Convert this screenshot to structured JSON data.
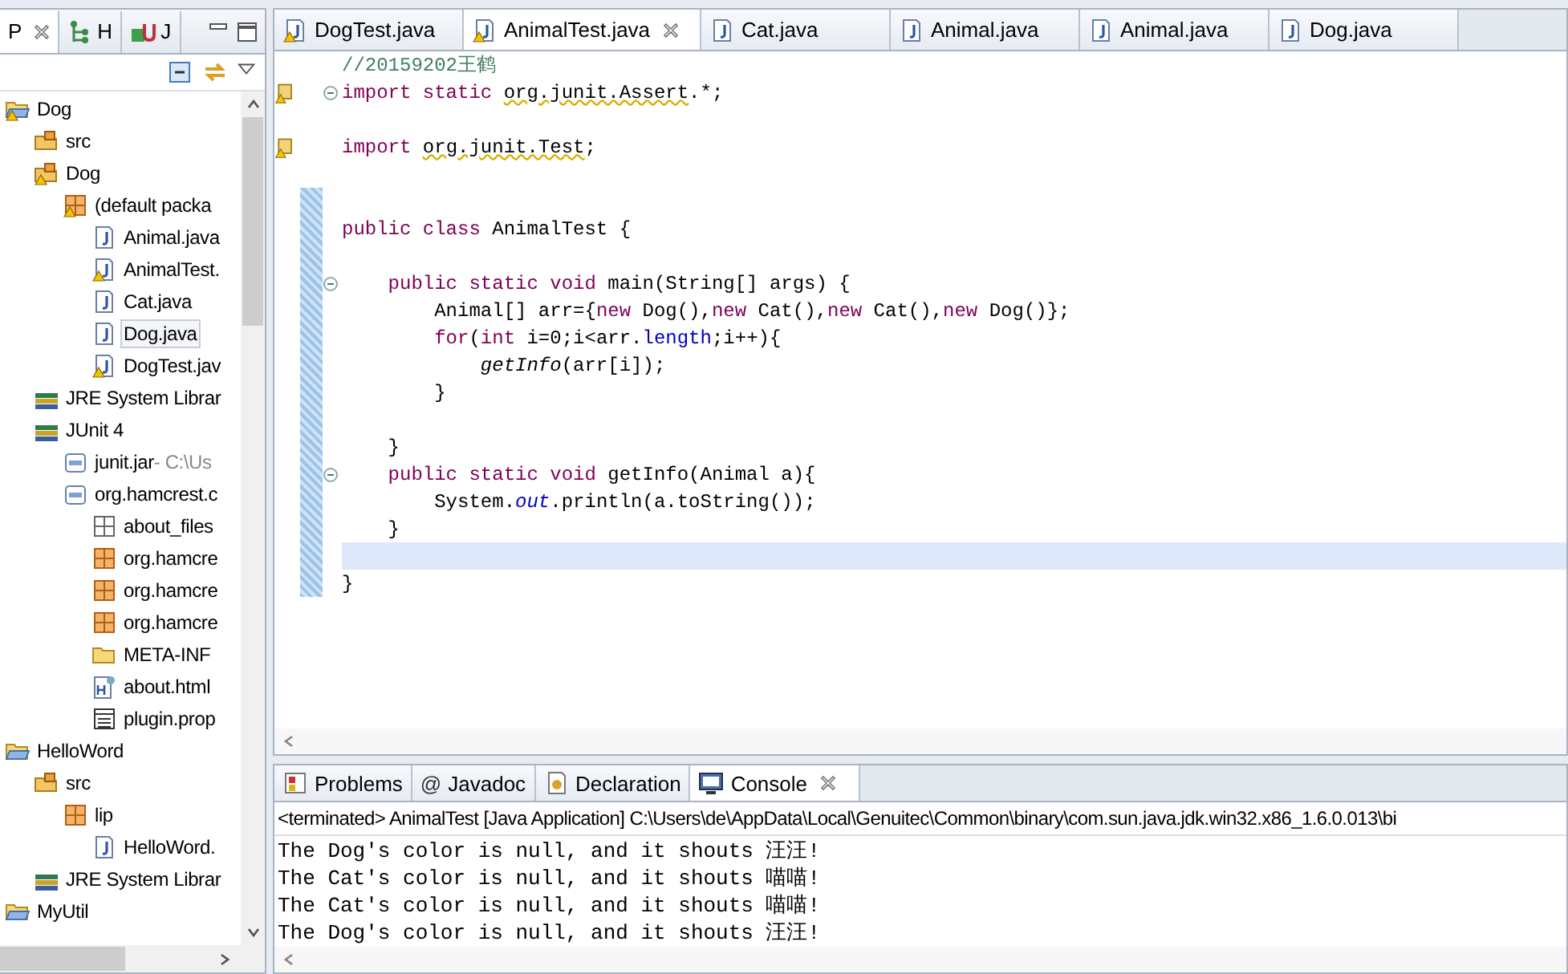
{
  "left_panel": {
    "tabs": [
      {
        "label": "P",
        "kind": "explorer",
        "selected": true
      },
      {
        "label": "H",
        "kind": "hierarchy",
        "selected": false
      },
      {
        "label": "J",
        "kind": "junit",
        "selected": false
      }
    ],
    "tree": [
      {
        "label": "Dog",
        "kind": "project",
        "warning": true,
        "selected": false,
        "children": [
          {
            "label": "src",
            "kind": "srcfolder",
            "warning": false,
            "selected": false
          },
          {
            "label": "Dog",
            "kind": "srcfolder",
            "warning": true,
            "selected": false,
            "children": [
              {
                "label": "(default packa",
                "kind": "package",
                "warning": true,
                "selected": false,
                "children": [
                  {
                    "label": "Animal.java",
                    "kind": "java",
                    "warning": false,
                    "selected": false
                  },
                  {
                    "label": "AnimalTest.",
                    "kind": "java",
                    "warning": true,
                    "selected": false
                  },
                  {
                    "label": "Cat.java",
                    "kind": "java",
                    "warning": false,
                    "selected": false
                  },
                  {
                    "label": "Dog.java",
                    "kind": "java",
                    "warning": false,
                    "selected": true
                  },
                  {
                    "label": "DogTest.jav",
                    "kind": "java",
                    "warning": true,
                    "selected": false
                  }
                ]
              }
            ]
          },
          {
            "label": "JRE System Librar",
            "kind": "library",
            "warning": false,
            "selected": false
          },
          {
            "label": "JUnit 4",
            "kind": "library",
            "warning": false,
            "selected": false,
            "children": [
              {
                "label": "junit.jar",
                "detail": "- C:\\Us",
                "kind": "jar",
                "warning": false,
                "selected": false
              },
              {
                "label": "org.hamcrest.c",
                "kind": "jar",
                "warning": false,
                "selected": false,
                "children": [
                  {
                    "label": "about_files",
                    "kind": "packagefolder",
                    "warning": false,
                    "selected": false
                  },
                  {
                    "label": "org.hamcre",
                    "kind": "package",
                    "warning": false,
                    "selected": false
                  },
                  {
                    "label": "org.hamcre",
                    "kind": "package",
                    "warning": false,
                    "selected": false
                  },
                  {
                    "label": "org.hamcre",
                    "kind": "package",
                    "warning": false,
                    "selected": false
                  },
                  {
                    "label": "META-INF",
                    "kind": "folder",
                    "warning": false,
                    "selected": false
                  },
                  {
                    "label": "about.html",
                    "kind": "html",
                    "warning": false,
                    "selected": false
                  },
                  {
                    "label": "plugin.prop",
                    "kind": "properties",
                    "warning": false,
                    "selected": false
                  }
                ]
              }
            ]
          }
        ]
      },
      {
        "label": "HelloWord",
        "kind": "project",
        "warning": false,
        "selected": false,
        "children": [
          {
            "label": "src",
            "kind": "srcfolder",
            "warning": false,
            "selected": false,
            "children": [
              {
                "label": "lip",
                "kind": "package",
                "warning": false,
                "selected": false,
                "children": [
                  {
                    "label": "HelloWord.",
                    "kind": "java",
                    "warning": false,
                    "selected": false
                  }
                ]
              }
            ]
          },
          {
            "label": "JRE System Librar",
            "kind": "library",
            "warning": false,
            "selected": false
          }
        ]
      },
      {
        "label": "MyUtil",
        "kind": "project",
        "warning": false,
        "selected": false
      }
    ]
  },
  "editor": {
    "tabs": [
      {
        "label": "DogTest.java",
        "warning": true,
        "selected": false
      },
      {
        "label": "AnimalTest.java",
        "warning": true,
        "selected": true
      },
      {
        "label": "Cat.java",
        "warning": false,
        "selected": false
      },
      {
        "label": "Animal.java",
        "warning": false,
        "selected": false
      },
      {
        "label": "Animal.java",
        "warning": false,
        "selected": false
      },
      {
        "label": "Dog.java",
        "warning": false,
        "selected": false
      }
    ],
    "lines": [
      {
        "changed": false,
        "current": false,
        "tokens": [
          {
            "kind": "comment",
            "text": "//20159202王鹤"
          }
        ]
      },
      {
        "changed": false,
        "current": false,
        "markers": [
          {
            "kind": "warning"
          },
          {
            "kind": "fold"
          }
        ],
        "tokens": [
          {
            "kind": "keyword",
            "text": "import static "
          },
          {
            "kind": "warn",
            "text": "org.junit.Assert"
          },
          {
            "kind": "plain",
            "text": ".*;"
          }
        ]
      },
      {
        "changed": false,
        "current": false
      },
      {
        "changed": false,
        "current": false,
        "markers": [
          {
            "kind": "warning"
          }
        ],
        "tokens": [
          {
            "kind": "keyword",
            "text": "import "
          },
          {
            "kind": "warn",
            "text": "org.junit.Test"
          },
          {
            "kind": "plain",
            "text": ";"
          }
        ]
      },
      {
        "changed": false,
        "current": false
      },
      {
        "changed": true,
        "current": false
      },
      {
        "changed": true,
        "current": false,
        "tokens": [
          {
            "kind": "keyword",
            "text": "public class"
          },
          {
            "kind": "plain",
            "text": " AnimalTest {"
          }
        ]
      },
      {
        "changed": true,
        "current": false
      },
      {
        "changed": true,
        "current": false,
        "markers": [
          {
            "kind": "fold"
          }
        ],
        "tokens": [
          {
            "kind": "keyword",
            "text": "    public static void"
          },
          {
            "kind": "plain",
            "text": " main(String[] args) {"
          }
        ]
      },
      {
        "changed": true,
        "current": false,
        "tokens": [
          {
            "kind": "plain",
            "text": "        Animal[] arr={"
          },
          {
            "kind": "keyword",
            "text": "new"
          },
          {
            "kind": "plain",
            "text": " Dog(),"
          },
          {
            "kind": "keyword",
            "text": "new"
          },
          {
            "kind": "plain",
            "text": " Cat(),"
          },
          {
            "kind": "keyword",
            "text": "new"
          },
          {
            "kind": "plain",
            "text": " Cat(),"
          },
          {
            "kind": "keyword",
            "text": "new"
          },
          {
            "kind": "plain",
            "text": " Dog()};"
          }
        ]
      },
      {
        "changed": true,
        "current": false,
        "tokens": [
          {
            "kind": "keyword",
            "text": "        for"
          },
          {
            "kind": "plain",
            "text": "("
          },
          {
            "kind": "keyword",
            "text": "int"
          },
          {
            "kind": "plain",
            "text": " i=0;i<arr."
          },
          {
            "kind": "field",
            "text": "length"
          },
          {
            "kind": "plain",
            "text": ";i++){"
          }
        ]
      },
      {
        "changed": true,
        "current": false,
        "tokens": [
          {
            "kind": "static-method",
            "text": "            getInfo"
          },
          {
            "kind": "plain",
            "text": "(arr[i]);"
          }
        ]
      },
      {
        "changed": true,
        "current": false,
        "tokens": [
          {
            "kind": "plain",
            "text": "        }"
          }
        ]
      },
      {
        "changed": true,
        "current": false
      },
      {
        "changed": true,
        "current": false,
        "tokens": [
          {
            "kind": "plain",
            "text": "    }"
          }
        ]
      },
      {
        "changed": true,
        "current": false,
        "markers": [
          {
            "kind": "fold"
          }
        ],
        "tokens": [
          {
            "kind": "keyword",
            "text": "    public static void"
          },
          {
            "kind": "plain",
            "text": " getInfo(Animal a){"
          }
        ]
      },
      {
        "changed": true,
        "current": false,
        "tokens": [
          {
            "kind": "plain",
            "text": "        System."
          },
          {
            "kind": "static-field",
            "text": "out"
          },
          {
            "kind": "plain",
            "text": ".println(a.toString());"
          }
        ]
      },
      {
        "changed": true,
        "current": false,
        "tokens": [
          {
            "kind": "plain",
            "text": "    }"
          }
        ]
      },
      {
        "changed": true,
        "current": true
      },
      {
        "changed": true,
        "current": false,
        "tokens": [
          {
            "kind": "plain",
            "text": "}"
          }
        ]
      }
    ]
  },
  "bottom_panel": {
    "tabs": [
      {
        "label": "Problems",
        "kind": "problems",
        "selected": false
      },
      {
        "label": "Javadoc",
        "kind": "javadoc",
        "glyph": "@",
        "selected": false
      },
      {
        "label": "Declaration",
        "kind": "declaration",
        "selected": false
      },
      {
        "label": "Console",
        "kind": "console",
        "selected": true
      }
    ],
    "header": "<terminated> AnimalTest [Java Application] C:\\Users\\de\\AppData\\Local\\Genuitec\\Common\\binary\\com.sun.java.jdk.win32.x86_1.6.0.013\\bi",
    "output": [
      "The Dog's color is null, and it shouts 汪汪!",
      "The Cat's color is null, and it shouts 喵喵!",
      "The Cat's color is null, and it shouts 喵喵!",
      "The Dog's color is null, and it shouts 汪汪!"
    ]
  }
}
